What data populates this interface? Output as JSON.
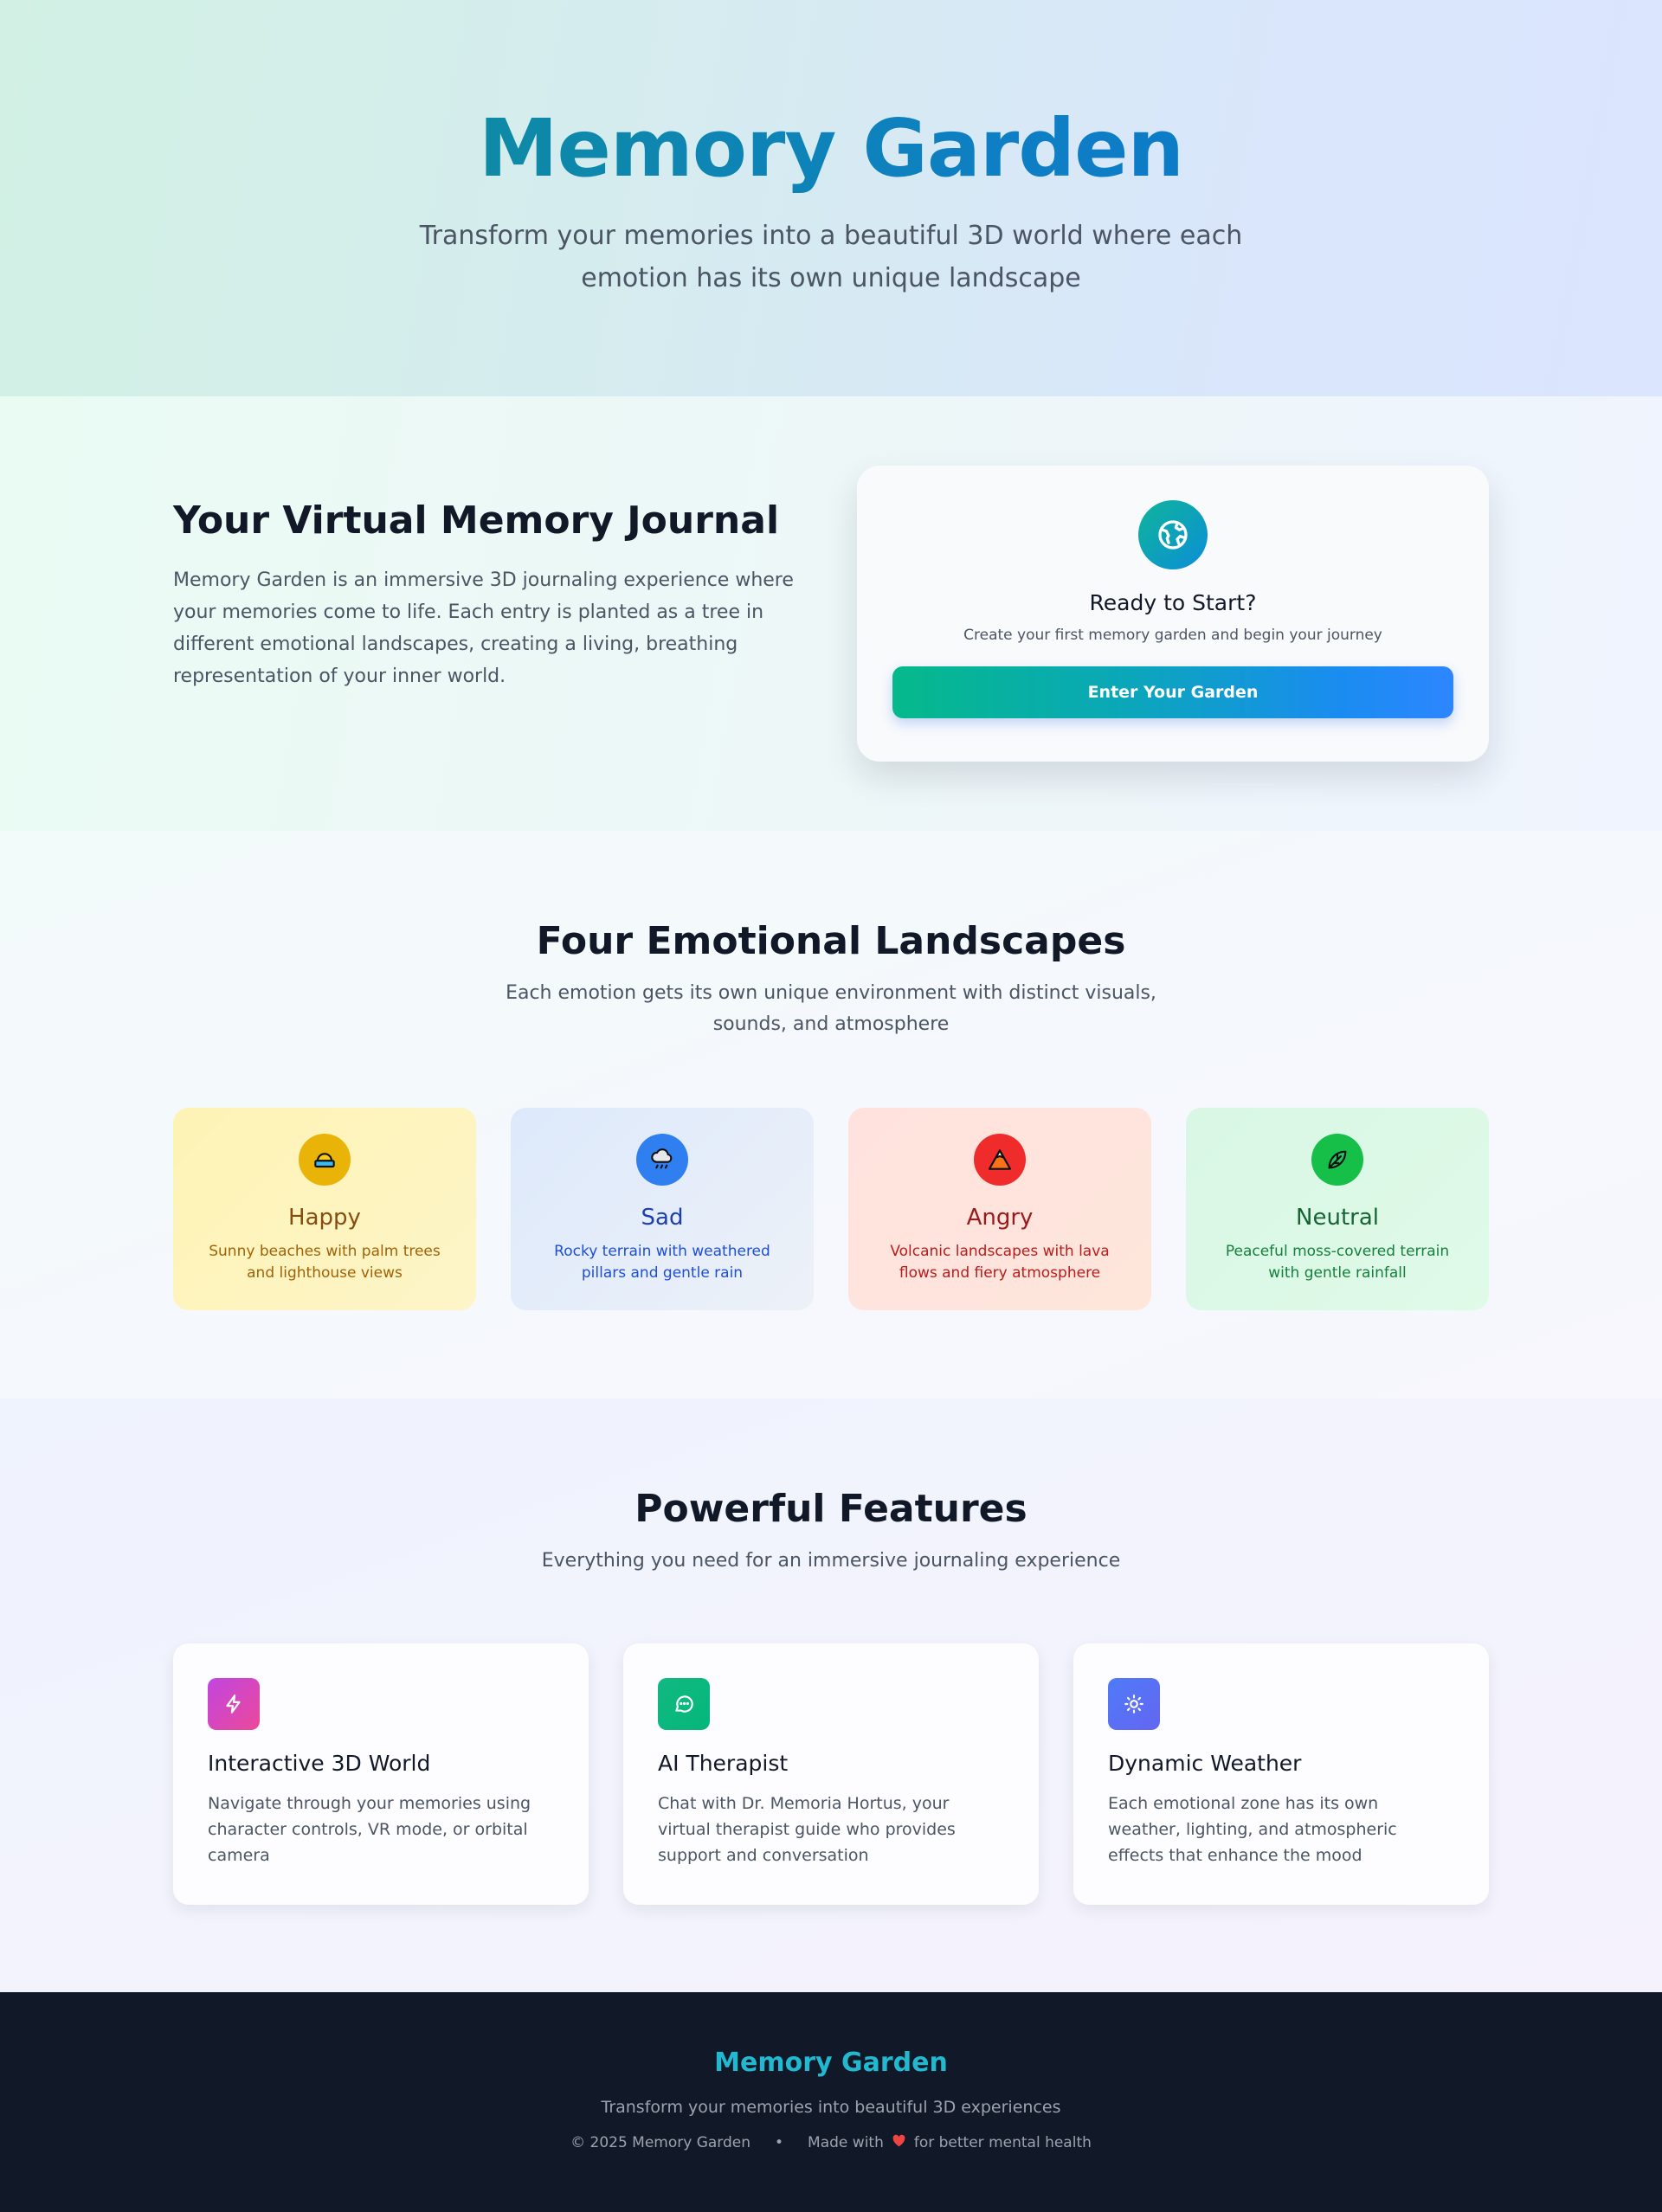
{
  "hero": {
    "title": "Memory Garden",
    "subtitle": "Transform your memories into a beautiful 3D world where each emotion has its own unique landscape"
  },
  "intro": {
    "heading": "Your Virtual Memory Journal",
    "body": "Memory Garden is an immersive 3D journaling experience where your memories come to life. Each entry is planted as a tree in different emotional landscapes, creating a living, breathing representation of your inner world.",
    "card": {
      "icon": "globe-icon",
      "title": "Ready to Start?",
      "subtitle": "Create your first memory garden and begin your journey",
      "button_label": "Enter Your Garden"
    }
  },
  "emotions": {
    "title": "Four Emotional Landscapes",
    "subtitle": "Each emotion gets its own unique environment with distinct visuals, sounds, and atmosphere",
    "items": [
      {
        "name": "Happy",
        "icon": "beach-icon",
        "desc": "Sunny beaches with palm trees and lighthouse views",
        "color": "#eab308"
      },
      {
        "name": "Sad",
        "icon": "rain-cloud-icon",
        "desc": "Rocky terrain with weathered pillars and gentle rain",
        "color": "#2f7ff0"
      },
      {
        "name": "Angry",
        "icon": "volcano-icon",
        "desc": "Volcanic landscapes with lava flows and fiery atmosphere",
        "color": "#ef2b2b"
      },
      {
        "name": "Neutral",
        "icon": "leaf-icon",
        "desc": "Peaceful moss-covered terrain with gentle rainfall",
        "color": "#16bf48"
      }
    ]
  },
  "features": {
    "title": "Powerful Features",
    "subtitle": "Everything you need for an immersive journaling experience",
    "items": [
      {
        "title": "Interactive 3D World",
        "icon": "lightning-icon",
        "desc": "Navigate through your memories using character controls, VR mode, or orbital camera"
      },
      {
        "title": "AI Therapist",
        "icon": "chat-bubble-icon",
        "desc": "Chat with Dr. Memoria Hortus, your virtual therapist guide who provides support and conversation"
      },
      {
        "title": "Dynamic Weather",
        "icon": "sun-icon",
        "desc": "Each emotional zone has its own weather, lighting, and atmospheric effects that enhance the mood"
      }
    ]
  },
  "footer": {
    "brand": "Memory Garden",
    "tagline": "Transform your memories into beautiful 3D experiences",
    "copyright": "© 2025 Memory Garden",
    "separator": "•",
    "made_with_prefix": "Made with",
    "made_with_suffix": "for better mental health",
    "heart_icon": "heart-icon",
    "heart_color": "#ef4444"
  },
  "colors": {
    "brand_teal": "#0d9488",
    "brand_blue": "#0a72cf",
    "footer_bg": "#111827"
  }
}
